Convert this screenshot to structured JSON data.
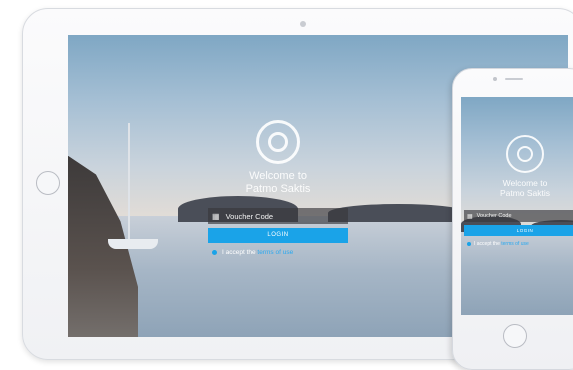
{
  "app": {
    "welcome_line1": "Welcome to",
    "welcome_line2": "Patmo Saktis",
    "voucher_placeholder": "Voucher Code",
    "login_label": "LOGIN",
    "terms_prefix": "I accept the",
    "terms_link": "terms of use"
  },
  "icons": {
    "logo": "ring-logo-icon",
    "voucher": "voucher-icon",
    "checkbox": "radio-dot-icon"
  },
  "colors": {
    "accent": "#1aa3e8",
    "voucher_bg": "#37373c"
  }
}
